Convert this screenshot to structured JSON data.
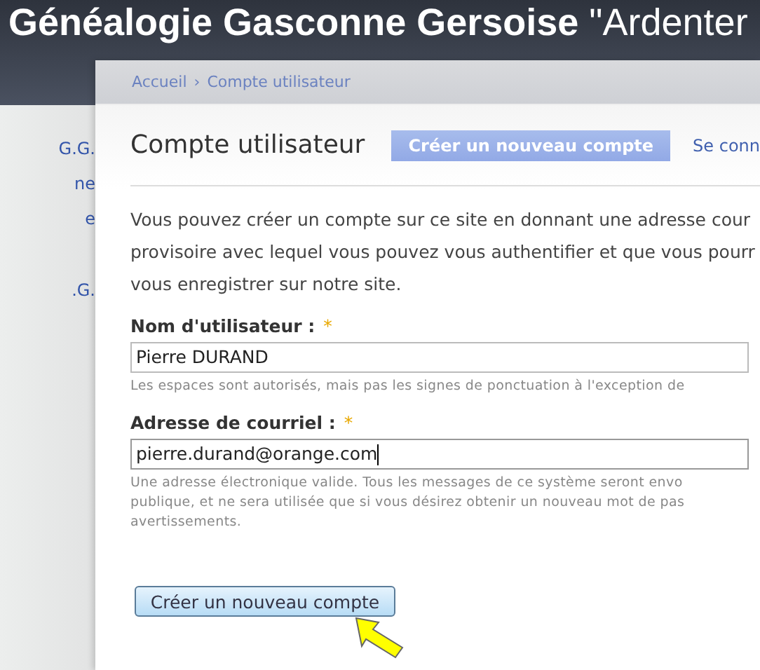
{
  "site_title": "**Généalogie Gasconne Gersoise** \"Ardenter",
  "sidebar": {
    "items": [
      "G.G.",
      "ne",
      "e",
      ".G."
    ]
  },
  "breadcrumb": [
    {
      "label": "Accueil"
    },
    {
      "label": "Compte utilisateur"
    }
  ],
  "breadcrumb_separator": "›",
  "page_title": "Compte utilisateur",
  "tabs": [
    {
      "label": "Créer un nouveau compte",
      "selected": true
    },
    {
      "label": "Se conn",
      "selected": false
    }
  ],
  "intro": [
    "Vous pouvez créer un compte sur ce site en donnant une adresse cour",
    "provisoire avec lequel vous pouvez vous authentifier et que vous pourr",
    "vous enregistrer sur notre site."
  ],
  "fields": [
    {
      "label": "Nom d'utilisateur :",
      "required_mark": "*",
      "value": "Pierre DURAND",
      "focused": false,
      "description": [
        "Les espaces sont autorisés, mais pas les signes de ponctuation à l'exception de"
      ]
    },
    {
      "label": "Adresse de courriel :",
      "required_mark": "*",
      "value": "pierre.durand@orange.com",
      "focused": true,
      "description": [
        "Une adresse électronique valide. Tous les messages de ce système seront envo",
        "publique, et ne sera utilisée que si vous désirez obtenir un nouveau mot de pas",
        "avertissements."
      ]
    }
  ],
  "submit_button": "Créer un nouveau compte"
}
